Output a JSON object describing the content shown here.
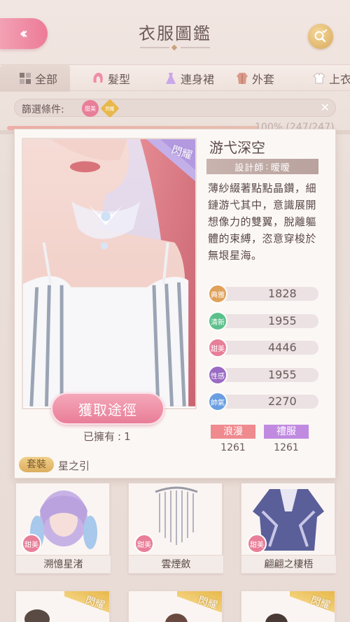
{
  "header": {
    "title": "衣服圖鑑",
    "back_icon": "back-double-chevron-icon",
    "search_icon": "magnifier-check-icon"
  },
  "tabs": [
    {
      "label": "全部",
      "icon": "grid-icon"
    },
    {
      "label": "髮型",
      "icon": "hair-icon"
    },
    {
      "label": "連身裙",
      "icon": "dress-icon"
    },
    {
      "label": "外套",
      "icon": "coat-icon"
    },
    {
      "label": "上衣",
      "icon": "shirt-icon"
    }
  ],
  "filter": {
    "label": "篩選條件:",
    "tags": [
      {
        "text": "甜美",
        "color": "#e87e98"
      },
      {
        "text": "閃耀",
        "color": "#e8b84a"
      }
    ],
    "clear_icon": "close-icon"
  },
  "progress": {
    "text": "100% (247/247)",
    "percent": 100
  },
  "detail": {
    "rarity": "閃耀",
    "name": "游弋深空",
    "designer_label": "設計師",
    "designer_sep": ":",
    "designer": "暧暧",
    "description": "薄紗綴著點點晶鑽，細鏈游弋其中，意識展開想像力的雙翼，脫離軀體的束縛，恣意穿梭於無垠星海。",
    "stats": [
      {
        "label": "典雅",
        "value": "1828",
        "color": "#e0a15a"
      },
      {
        "label": "清新",
        "value": "1955",
        "color": "#5cc08a"
      },
      {
        "label": "甜美",
        "value": "4446",
        "color": "#e87e98"
      },
      {
        "label": "性感",
        "value": "1955",
        "color": "#9a6ac4"
      },
      {
        "label": "帥氣",
        "value": "2270",
        "color": "#6a9ee0"
      }
    ],
    "style_tags": [
      {
        "label": "浪漫",
        "value": "1261",
        "color": "#ef8a8e"
      },
      {
        "label": "禮服",
        "value": "1261",
        "color": "#c08ae0"
      }
    ],
    "acquire_label": "獲取途徑",
    "owned_label": "已擁有",
    "owned_sep": ":",
    "owned_count": "1",
    "set_tag": "套裝",
    "set_name": "星之引"
  },
  "grid_items": [
    {
      "name": "溯憶星渚",
      "badge": "甜美",
      "rarity": ""
    },
    {
      "name": "雲煙斂",
      "badge": "甜美",
      "rarity": ""
    },
    {
      "name": "翩翩之棲梧",
      "badge": "甜美",
      "rarity": ""
    },
    {
      "name": "",
      "badge": "",
      "rarity": "閃耀"
    },
    {
      "name": "",
      "badge": "",
      "rarity": "閃耀"
    },
    {
      "name": "",
      "badge": "",
      "rarity": "閃耀"
    }
  ]
}
